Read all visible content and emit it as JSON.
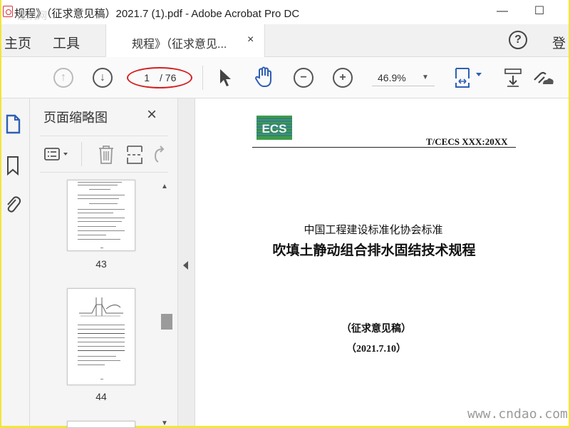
{
  "window": {
    "title": "规程》（征求意见稿）2021.7 (1).pdf - Adobe Acrobat Pro DC",
    "watermark_top": "建筑网",
    "minimize": "—",
    "maximize": "☐"
  },
  "tabs": {
    "home": "主页",
    "tools": "工具",
    "doc_tab_label": "规程》（征求意见...",
    "doc_tab_close": "×",
    "help": "?",
    "signin": "登"
  },
  "toolbar": {
    "page_current": "1",
    "page_total": "/ 76",
    "zoom": "46.9%",
    "icons": [
      "arrow-up-icon",
      "arrow-down-icon",
      "select-pointer-icon",
      "hand-icon",
      "zoom-out-icon",
      "zoom-in-icon",
      "fit-page-icon",
      "scroll-mode-icon",
      "link-icon"
    ]
  },
  "pane": {
    "title": "页面缩略图",
    "close": "×",
    "thumbnails": [
      {
        "number": "43"
      },
      {
        "number": "44"
      }
    ]
  },
  "document": {
    "logo_text": "ECS",
    "standard_code": "T/CECS XXX:20XX",
    "org": "中国工程建设标准化协会标准",
    "title": "吹填土静动组合排水固结技术规程",
    "draft_label": "（征求意见稿）",
    "date": "（2021.7.10）"
  },
  "watermark": {
    "site": "www.cndao.com"
  },
  "colors": {
    "frame_yellow": "#f5e94a",
    "annotation_red": "#d51f1f",
    "rail_blue": "#2f5fb3",
    "ecs_green": "#3f9c4a"
  }
}
